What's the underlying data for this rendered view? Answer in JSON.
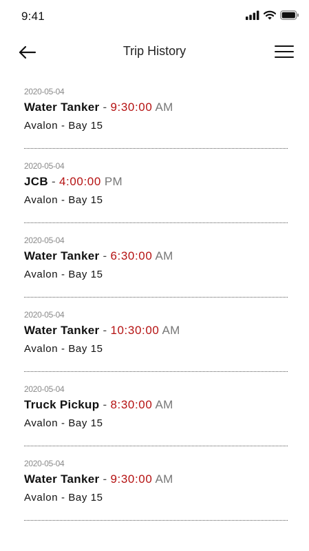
{
  "status_bar": {
    "time": "9:41",
    "icons": [
      "signal-icon",
      "wifi-icon",
      "battery-icon"
    ]
  },
  "header": {
    "title": "Trip History",
    "back_icon": "back-arrow-icon",
    "menu_icon": "hamburger-menu-icon"
  },
  "colors": {
    "time_accent": "#b51212",
    "date_gray": "#8a8a8a",
    "ampm_gray": "#777777"
  },
  "trips": [
    {
      "date": "2020-05-04",
      "vehicle": "Water Tanker",
      "separator": "-",
      "time": "9:30:00",
      "ampm": "AM",
      "location": "Avalon - Bay 15"
    },
    {
      "date": "2020-05-04",
      "vehicle": "JCB",
      "separator": "-",
      "time": "4:00:00",
      "ampm": "PM",
      "location": "Avalon - Bay 15"
    },
    {
      "date": "2020-05-04",
      "vehicle": "Water Tanker",
      "separator": "-",
      "time": "6:30:00",
      "ampm": "AM",
      "location": "Avalon - Bay 15"
    },
    {
      "date": "2020-05-04",
      "vehicle": "Water Tanker",
      "separator": "-",
      "time": "10:30:00",
      "ampm": "AM",
      "location": "Avalon - Bay 15"
    },
    {
      "date": "2020-05-04",
      "vehicle": "Truck Pickup",
      "separator": "-",
      "time": "8:30:00",
      "ampm": "AM",
      "location": "Avalon - Bay 15"
    },
    {
      "date": "2020-05-04",
      "vehicle": "Water Tanker",
      "separator": "-",
      "time": "9:30:00",
      "ampm": "AM",
      "location": "Avalon - Bay 15"
    }
  ]
}
